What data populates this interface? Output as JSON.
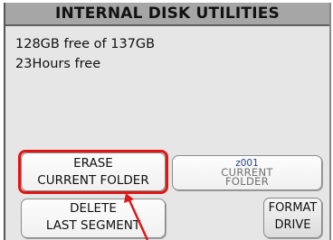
{
  "window": {
    "title": "INTERNAL DISK UTILITIES"
  },
  "status": {
    "free_space": "128GB free of 137GB",
    "free_time": "23Hours free"
  },
  "buttons": {
    "erase_current_folder": {
      "line1": "ERASE",
      "line2": "CURRENT FOLDER"
    },
    "current_folder": {
      "folder_id": "z001",
      "line1": "CURRENT",
      "line2": "FOLDER"
    },
    "delete_last_segment": {
      "line1": "DELETE",
      "line2": "LAST SEGMENT"
    },
    "format_drive": {
      "line1": "FORMAT",
      "line2": "DRIVE"
    }
  },
  "colors": {
    "title_bar": "#a6a6a6",
    "panel_background": "#e6e6e6",
    "highlight": "#e01616",
    "folder_id_text": "#1f3f99"
  }
}
